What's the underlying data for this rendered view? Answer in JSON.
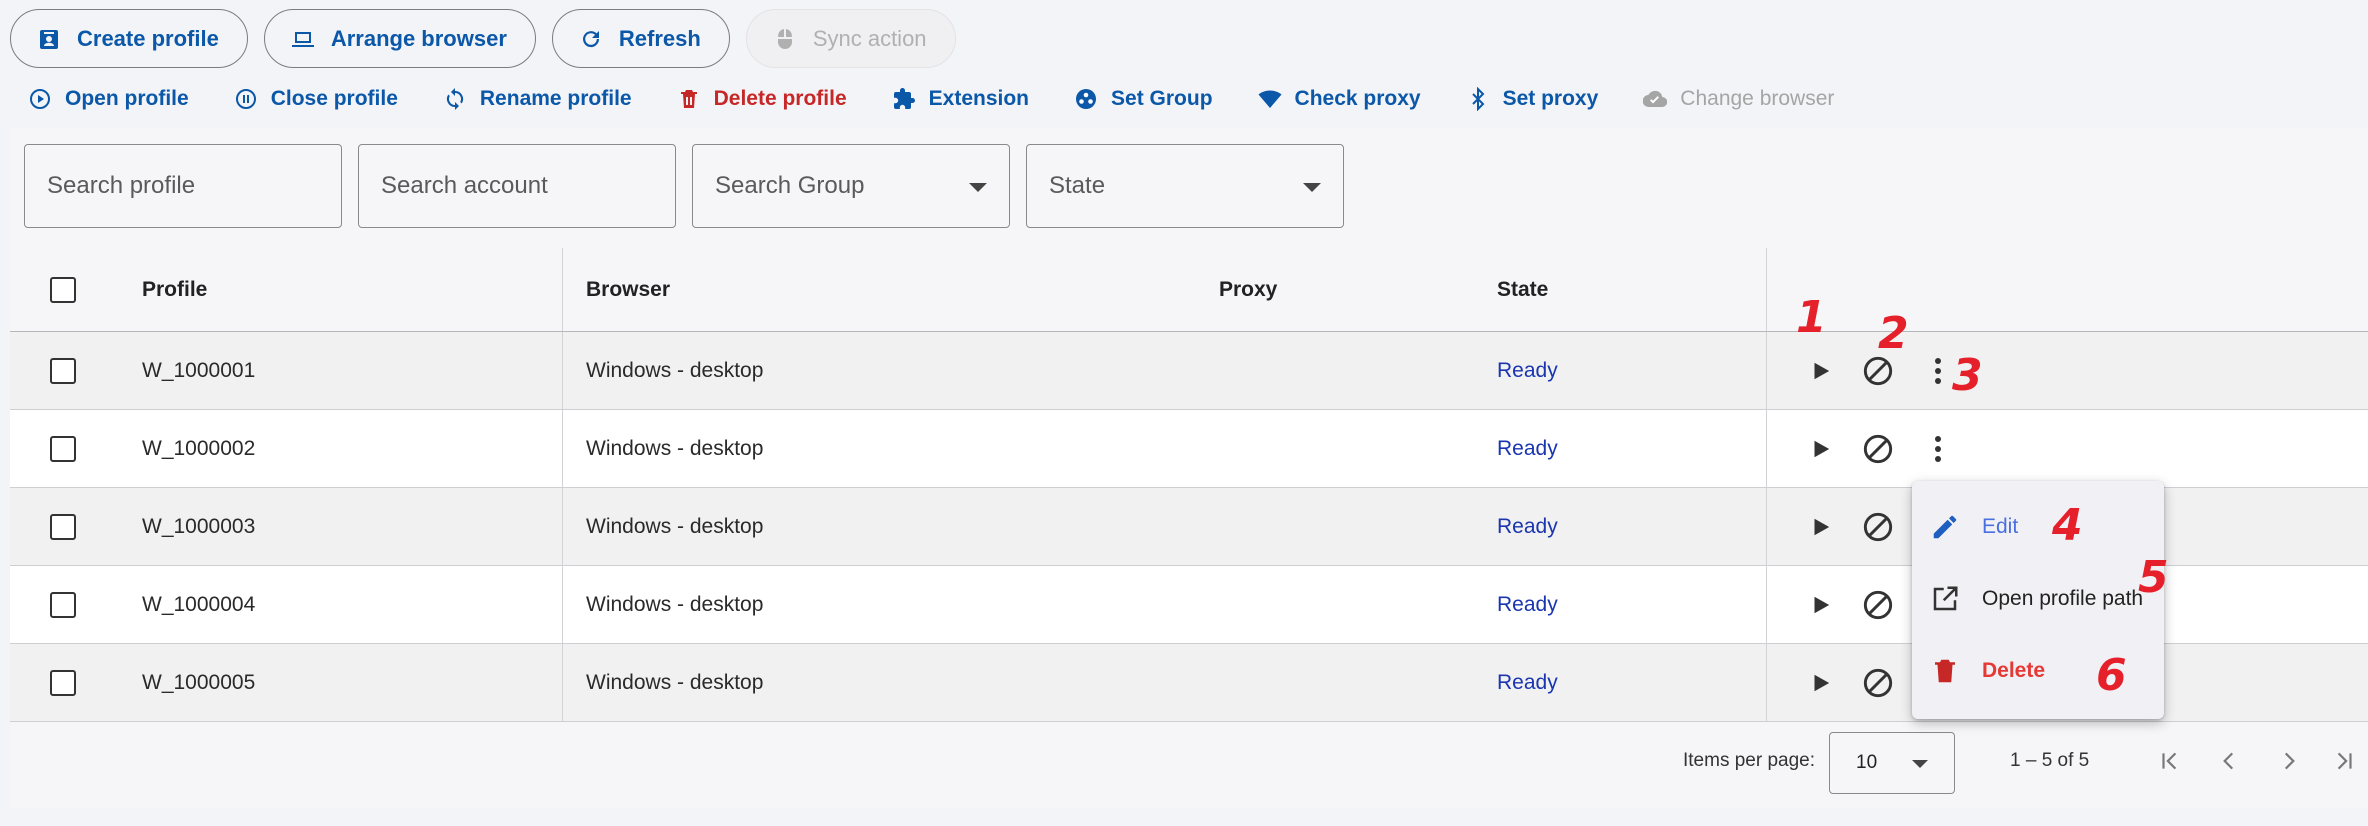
{
  "toolbar": {
    "create_profile": "Create profile",
    "arrange_browser": "Arrange browser",
    "refresh": "Refresh",
    "sync_action": "Sync action"
  },
  "actions": {
    "open_profile": "Open profile",
    "close_profile": "Close profile",
    "rename_profile": "Rename profile",
    "delete_profile": "Delete profile",
    "extension": "Extension",
    "set_group": "Set Group",
    "check_proxy": "Check proxy",
    "set_proxy": "Set proxy",
    "change_browser": "Change browser"
  },
  "filters": {
    "search_profile": "Search profile",
    "search_account": "Search account",
    "search_group": "Search Group",
    "state": "State"
  },
  "table": {
    "headers": {
      "profile": "Profile",
      "browser": "Browser",
      "proxy": "Proxy",
      "state": "State"
    },
    "rows": [
      {
        "profile": "W_1000001",
        "browser": "Windows - desktop",
        "proxy": "",
        "state": "Ready"
      },
      {
        "profile": "W_1000002",
        "browser": "Windows - desktop",
        "proxy": "",
        "state": "Ready"
      },
      {
        "profile": "W_1000003",
        "browser": "Windows - desktop",
        "proxy": "",
        "state": "Ready"
      },
      {
        "profile": "W_1000004",
        "browser": "Windows - desktop",
        "proxy": "",
        "state": "Ready"
      },
      {
        "profile": "W_1000005",
        "browser": "Windows - desktop",
        "proxy": "",
        "state": "Ready"
      }
    ]
  },
  "menu": {
    "edit": "Edit",
    "open_profile_path": "Open profile path",
    "delete": "Delete"
  },
  "annotations": [
    "1",
    "2",
    "3",
    "4",
    "5",
    "6"
  ],
  "paginator": {
    "items_per_page_label": "Items per page:",
    "items_per_page": "10",
    "range": "1 – 5 of 5"
  },
  "icons": {
    "create_profile": "badge-icon",
    "arrange_browser": "laptop-icon",
    "refresh": "refresh-icon",
    "sync_action": "mouse-icon",
    "open_profile": "play-circle-icon",
    "close_profile": "pause-circle-icon",
    "rename_profile": "sync-icon",
    "delete_profile": "trash-icon",
    "extension": "puzzle-icon",
    "set_group": "group-icon",
    "check_proxy": "wifi-icon",
    "set_proxy": "bluetooth-icon",
    "change_browser": "cloud-icon"
  },
  "colors": {
    "accent": "#0b57a8",
    "danger": "#c62828",
    "state": "#1a35b0",
    "menu_edit": "#4a6fe0",
    "menu_delete": "#e53935",
    "annotation": "#e5202a"
  }
}
